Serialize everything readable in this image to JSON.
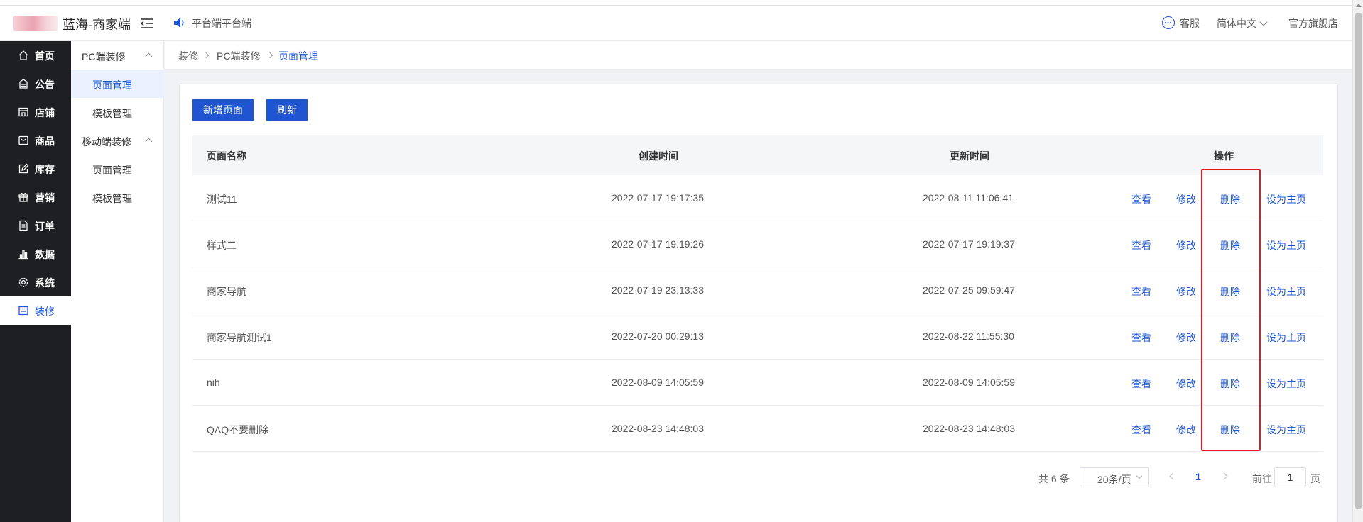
{
  "header": {
    "app_title": "蓝海-商家端",
    "notice": "平台端平台端",
    "service": "客服",
    "language": "简体中文",
    "store": "官方旗舰店"
  },
  "sidebar": {
    "items": [
      {
        "label": "首页",
        "icon": "home-icon"
      },
      {
        "label": "公告",
        "icon": "notice-board-icon"
      },
      {
        "label": "店铺",
        "icon": "shop-icon"
      },
      {
        "label": "商品",
        "icon": "goods-icon"
      },
      {
        "label": "库存",
        "icon": "edit-icon"
      },
      {
        "label": "营销",
        "icon": "gift-icon"
      },
      {
        "label": "订单",
        "icon": "document-icon"
      },
      {
        "label": "数据",
        "icon": "bar-chart-icon"
      },
      {
        "label": "系统",
        "icon": "gear-icon"
      },
      {
        "label": "装修",
        "icon": "decorate-icon",
        "active": true
      }
    ]
  },
  "submenu": {
    "group1": "PC端装修",
    "group1_items": [
      "页面管理",
      "模板管理"
    ],
    "group2": "移动端装修",
    "group2_items": [
      "页面管理",
      "模板管理"
    ]
  },
  "breadcrumb": [
    "装修",
    "PC端装修",
    "页面管理"
  ],
  "toolbar": {
    "add_label": "新增页面",
    "refresh_label": "刷新"
  },
  "table": {
    "headers": [
      "页面名称",
      "创建时间",
      "更新时间",
      "操作"
    ],
    "actions": [
      "查看",
      "修改",
      "删除",
      "设为主页"
    ],
    "rows": [
      {
        "name": "测试11",
        "created": "2022-07-17 19:17:35",
        "updated": "2022-08-11 11:06:41"
      },
      {
        "name": "样式二",
        "created": "2022-07-17 19:19:26",
        "updated": "2022-07-17 19:19:37"
      },
      {
        "name": "商家导航",
        "created": "2022-07-19 23:13:33",
        "updated": "2022-07-25 09:59:47"
      },
      {
        "name": "商家导航测试1",
        "created": "2022-07-20 00:29:13",
        "updated": "2022-08-22 11:55:30"
      },
      {
        "name": "nih",
        "created": "2022-08-09 14:05:59",
        "updated": "2022-08-09 14:05:59"
      },
      {
        "name": "QAQ不要删除",
        "created": "2022-08-23 14:48:03",
        "updated": "2022-08-23 14:48:03"
      }
    ]
  },
  "pagination": {
    "total": "共 6 条",
    "page_size": "20条/页",
    "current_page": "1",
    "goto_label": "前往",
    "goto_value": "1",
    "page_unit": "页"
  },
  "colors": {
    "accent": "#1f55d1",
    "sidebar_bg": "#1e1f22",
    "highlight_box": "#e5191f"
  }
}
